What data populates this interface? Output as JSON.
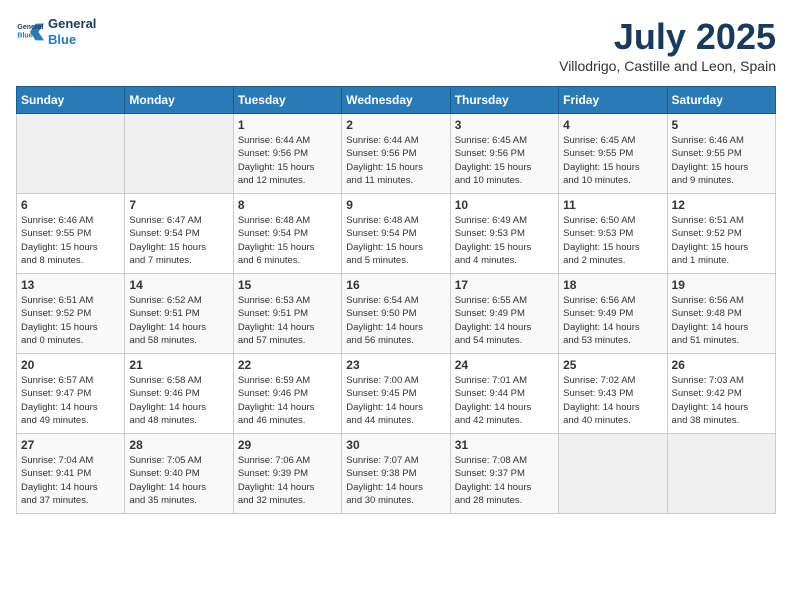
{
  "header": {
    "logo_line1": "General",
    "logo_line2": "Blue",
    "month_title": "July 2025",
    "subtitle": "Villodrigo, Castille and Leon, Spain"
  },
  "weekdays": [
    "Sunday",
    "Monday",
    "Tuesday",
    "Wednesday",
    "Thursday",
    "Friday",
    "Saturday"
  ],
  "weeks": [
    [
      {
        "day": "",
        "info": ""
      },
      {
        "day": "",
        "info": ""
      },
      {
        "day": "1",
        "info": "Sunrise: 6:44 AM\nSunset: 9:56 PM\nDaylight: 15 hours\nand 12 minutes."
      },
      {
        "day": "2",
        "info": "Sunrise: 6:44 AM\nSunset: 9:56 PM\nDaylight: 15 hours\nand 11 minutes."
      },
      {
        "day": "3",
        "info": "Sunrise: 6:45 AM\nSunset: 9:56 PM\nDaylight: 15 hours\nand 10 minutes."
      },
      {
        "day": "4",
        "info": "Sunrise: 6:45 AM\nSunset: 9:55 PM\nDaylight: 15 hours\nand 10 minutes."
      },
      {
        "day": "5",
        "info": "Sunrise: 6:46 AM\nSunset: 9:55 PM\nDaylight: 15 hours\nand 9 minutes."
      }
    ],
    [
      {
        "day": "6",
        "info": "Sunrise: 6:46 AM\nSunset: 9:55 PM\nDaylight: 15 hours\nand 8 minutes."
      },
      {
        "day": "7",
        "info": "Sunrise: 6:47 AM\nSunset: 9:54 PM\nDaylight: 15 hours\nand 7 minutes."
      },
      {
        "day": "8",
        "info": "Sunrise: 6:48 AM\nSunset: 9:54 PM\nDaylight: 15 hours\nand 6 minutes."
      },
      {
        "day": "9",
        "info": "Sunrise: 6:48 AM\nSunset: 9:54 PM\nDaylight: 15 hours\nand 5 minutes."
      },
      {
        "day": "10",
        "info": "Sunrise: 6:49 AM\nSunset: 9:53 PM\nDaylight: 15 hours\nand 4 minutes."
      },
      {
        "day": "11",
        "info": "Sunrise: 6:50 AM\nSunset: 9:53 PM\nDaylight: 15 hours\nand 2 minutes."
      },
      {
        "day": "12",
        "info": "Sunrise: 6:51 AM\nSunset: 9:52 PM\nDaylight: 15 hours\nand 1 minute."
      }
    ],
    [
      {
        "day": "13",
        "info": "Sunrise: 6:51 AM\nSunset: 9:52 PM\nDaylight: 15 hours\nand 0 minutes."
      },
      {
        "day": "14",
        "info": "Sunrise: 6:52 AM\nSunset: 9:51 PM\nDaylight: 14 hours\nand 58 minutes."
      },
      {
        "day": "15",
        "info": "Sunrise: 6:53 AM\nSunset: 9:51 PM\nDaylight: 14 hours\nand 57 minutes."
      },
      {
        "day": "16",
        "info": "Sunrise: 6:54 AM\nSunset: 9:50 PM\nDaylight: 14 hours\nand 56 minutes."
      },
      {
        "day": "17",
        "info": "Sunrise: 6:55 AM\nSunset: 9:49 PM\nDaylight: 14 hours\nand 54 minutes."
      },
      {
        "day": "18",
        "info": "Sunrise: 6:56 AM\nSunset: 9:49 PM\nDaylight: 14 hours\nand 53 minutes."
      },
      {
        "day": "19",
        "info": "Sunrise: 6:56 AM\nSunset: 9:48 PM\nDaylight: 14 hours\nand 51 minutes."
      }
    ],
    [
      {
        "day": "20",
        "info": "Sunrise: 6:57 AM\nSunset: 9:47 PM\nDaylight: 14 hours\nand 49 minutes."
      },
      {
        "day": "21",
        "info": "Sunrise: 6:58 AM\nSunset: 9:46 PM\nDaylight: 14 hours\nand 48 minutes."
      },
      {
        "day": "22",
        "info": "Sunrise: 6:59 AM\nSunset: 9:46 PM\nDaylight: 14 hours\nand 46 minutes."
      },
      {
        "day": "23",
        "info": "Sunrise: 7:00 AM\nSunset: 9:45 PM\nDaylight: 14 hours\nand 44 minutes."
      },
      {
        "day": "24",
        "info": "Sunrise: 7:01 AM\nSunset: 9:44 PM\nDaylight: 14 hours\nand 42 minutes."
      },
      {
        "day": "25",
        "info": "Sunrise: 7:02 AM\nSunset: 9:43 PM\nDaylight: 14 hours\nand 40 minutes."
      },
      {
        "day": "26",
        "info": "Sunrise: 7:03 AM\nSunset: 9:42 PM\nDaylight: 14 hours\nand 38 minutes."
      }
    ],
    [
      {
        "day": "27",
        "info": "Sunrise: 7:04 AM\nSunset: 9:41 PM\nDaylight: 14 hours\nand 37 minutes."
      },
      {
        "day": "28",
        "info": "Sunrise: 7:05 AM\nSunset: 9:40 PM\nDaylight: 14 hours\nand 35 minutes."
      },
      {
        "day": "29",
        "info": "Sunrise: 7:06 AM\nSunset: 9:39 PM\nDaylight: 14 hours\nand 32 minutes."
      },
      {
        "day": "30",
        "info": "Sunrise: 7:07 AM\nSunset: 9:38 PM\nDaylight: 14 hours\nand 30 minutes."
      },
      {
        "day": "31",
        "info": "Sunrise: 7:08 AM\nSunset: 9:37 PM\nDaylight: 14 hours\nand 28 minutes."
      },
      {
        "day": "",
        "info": ""
      },
      {
        "day": "",
        "info": ""
      }
    ]
  ]
}
